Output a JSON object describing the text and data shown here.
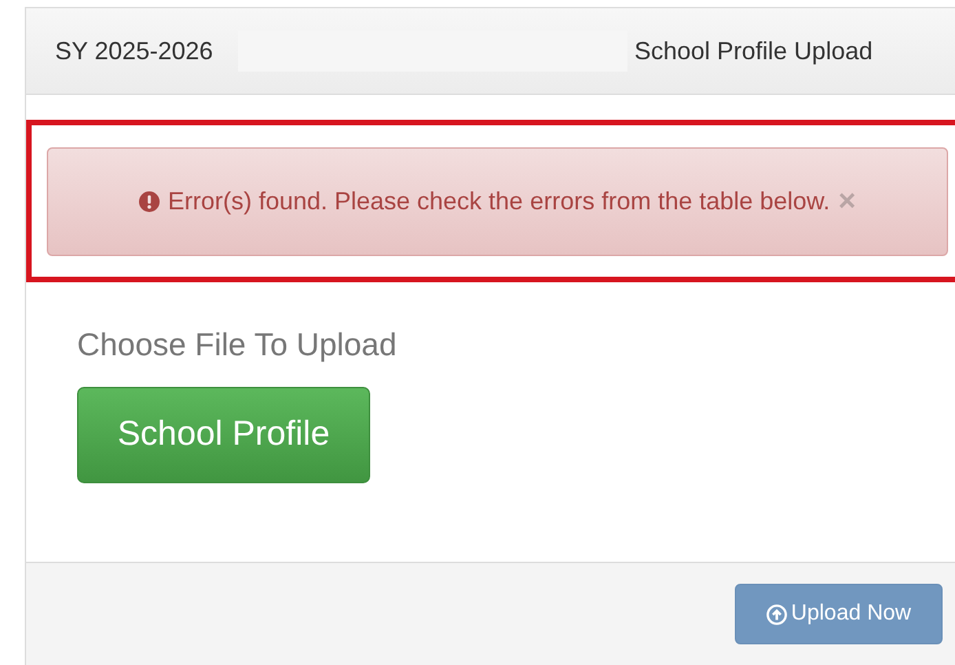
{
  "header": {
    "school_year": "SY 2025-2026",
    "title": "School Profile Upload"
  },
  "alert": {
    "kind": "error",
    "message": "Error(s) found. Please check the errors from the table below.",
    "close": "×",
    "highlighted": true
  },
  "upload": {
    "label": "Choose File To Upload",
    "file_button": "School Profile"
  },
  "footer": {
    "submit": {
      "label": "Upload Now",
      "disabled": true
    }
  }
}
